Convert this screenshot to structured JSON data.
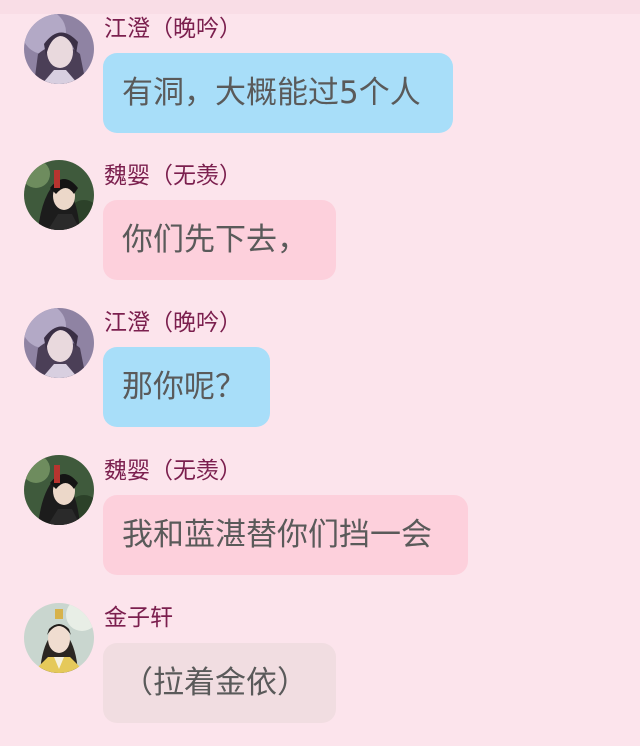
{
  "messages": [
    {
      "sender": "江澄（晚吟）",
      "text": "有洞，大概能过5个人",
      "avatar": "jiang-cheng-avatar"
    },
    {
      "sender": "魏婴（无羡）",
      "text": "你们先下去，",
      "avatar": "wei-ying-avatar"
    },
    {
      "sender": "江澄（晚吟）",
      "text": "那你呢？",
      "avatar": "jiang-cheng-avatar"
    },
    {
      "sender": "魏婴（无羡）",
      "text": "我和蓝湛替你们挡一会",
      "avatar": "wei-ying-avatar"
    },
    {
      "sender": "金子轩",
      "text": "（拉着金依）",
      "avatar": "jin-zixuan-avatar"
    }
  ],
  "colors": {
    "background": "#fce4ec",
    "name": "#7b1f4e",
    "bubble_blue": "#a8def9",
    "bubble_pink": "#fdd0dc",
    "bubble_beige": "#f1dde1"
  }
}
